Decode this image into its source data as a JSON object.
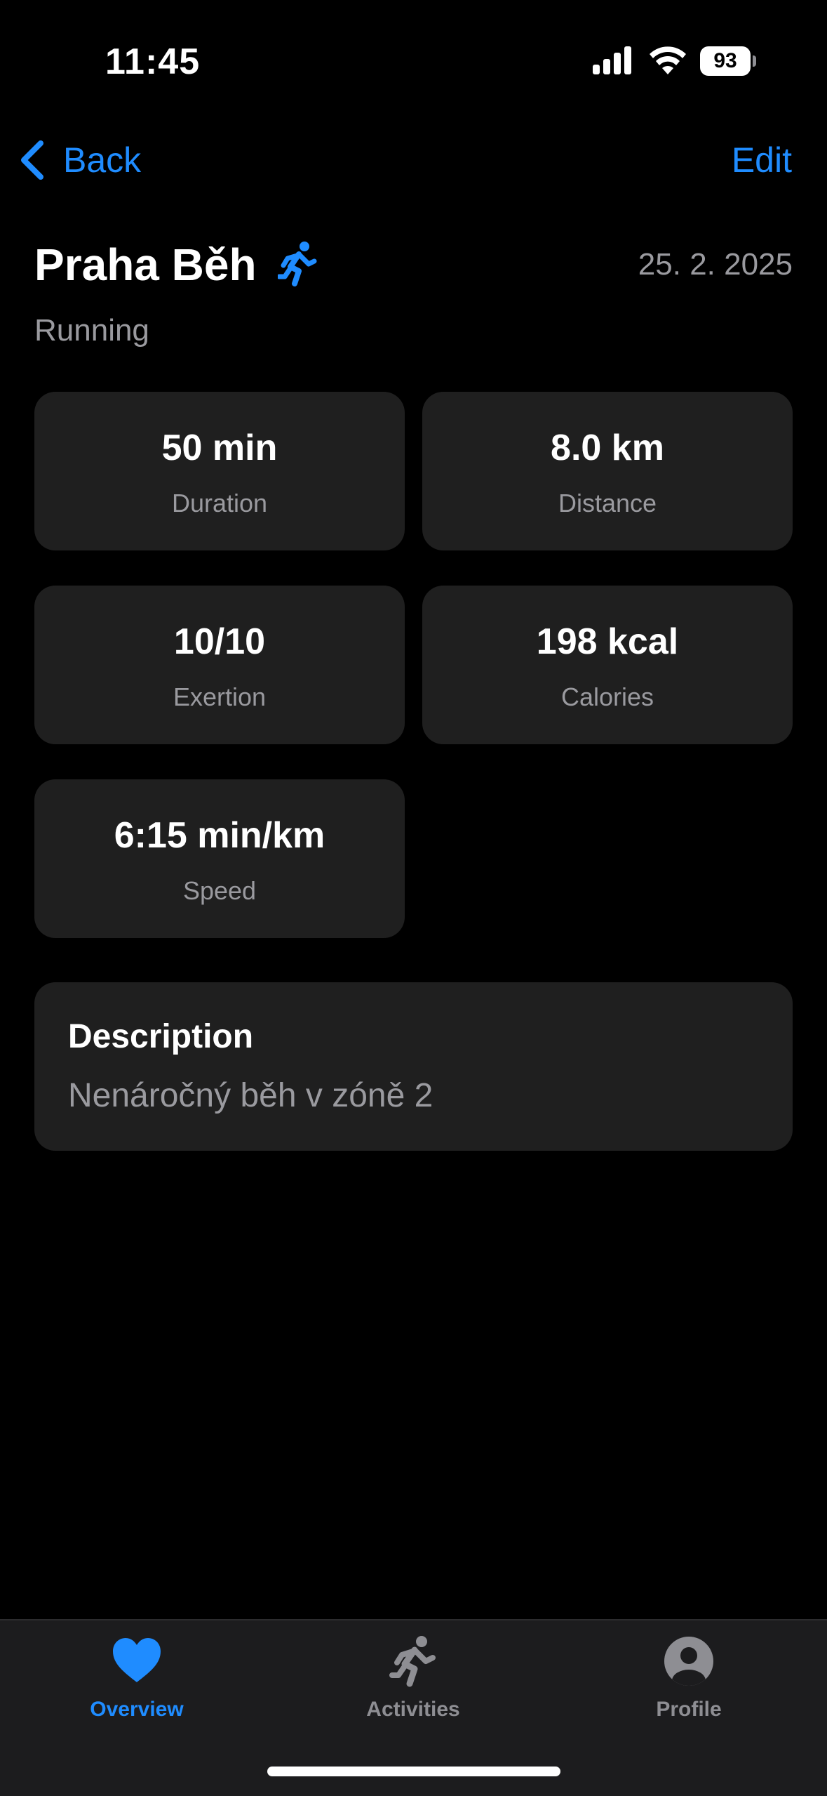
{
  "status_bar": {
    "time": "11:45",
    "battery": "93",
    "icons": [
      "signal-icon",
      "wifi-icon",
      "battery-icon"
    ]
  },
  "nav": {
    "back_label": "Back",
    "edit_label": "Edit",
    "back_icon": "chevron-left-icon"
  },
  "activity": {
    "title": "Praha Běh",
    "type_icon": "running-icon",
    "date": "25. 2. 2025",
    "subtitle": "Running"
  },
  "stats": [
    {
      "value": "50 min",
      "label": "Duration"
    },
    {
      "value": "8.0 km",
      "label": "Distance"
    },
    {
      "value": "10/10",
      "label": "Exertion"
    },
    {
      "value": "198 kcal",
      "label": "Calories"
    },
    {
      "value": "6:15 min/km",
      "label": "Speed"
    }
  ],
  "description": {
    "title": "Description",
    "text": "Nenáročný běh v zóně 2"
  },
  "tabs": [
    {
      "label": "Overview",
      "icon": "heart-icon",
      "active": true
    },
    {
      "label": "Activities",
      "icon": "running-icon",
      "active": false
    },
    {
      "label": "Profile",
      "icon": "person-circle-icon",
      "active": false
    }
  ],
  "colors": {
    "accent": "#1f8cff",
    "background": "#000000",
    "card": "#1f1f1f",
    "secondary_text": "#9a9a9f",
    "tab_bar": "#1c1c1e"
  }
}
